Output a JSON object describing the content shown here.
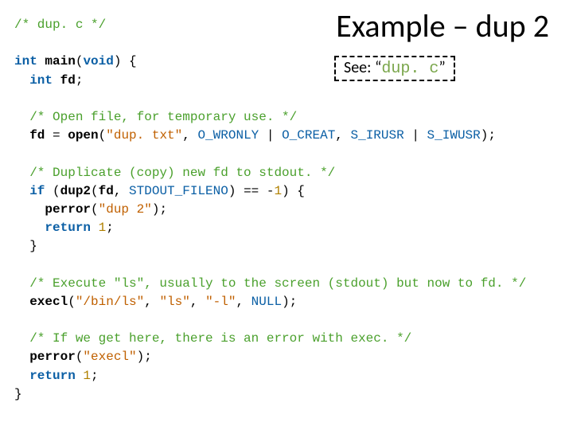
{
  "title": "Example – dup 2",
  "see": {
    "prefix": "See: “",
    "filename": "dup. c",
    "suffix": "”"
  },
  "code": {
    "l01_comment": "/* dup. c */",
    "l03_ty_int": "int",
    "l03_fn_main": "main",
    "l03_ty_void": "void",
    "l04_ty_int": "int",
    "l04_id_fd": "fd",
    "l06_comment": "/* Open file, for temporary use. */",
    "l07_id_fd": "fd",
    "l07_fn_open": "open",
    "l07_str": "\"dup. txt\"",
    "l07_c_owronly": "O_WRONLY",
    "l07_c_ocreat": "O_CREAT",
    "l07_c_sirusr": "S_IRUSR",
    "l07_c_siwusr": "S_IWUSR",
    "l09_comment": "/* Duplicate (copy) new fd to stdout. */",
    "l10_kw_if": "if",
    "l10_fn_dup2": "dup2",
    "l10_id_fd": "fd",
    "l10_c_stdout": "STDOUT_FILENO",
    "l10_num": "1",
    "l11_fn_perror": "perror",
    "l11_str": "\"dup 2\"",
    "l12_kw_return": "return",
    "l12_num": "1",
    "l15_comment": "/* Execute \"ls\", usually to the screen (stdout) but now to fd. */",
    "l16_fn_execl": "execl",
    "l16_str1": "\"/bin/ls\"",
    "l16_str2": "\"ls\"",
    "l16_str3": "\"-l\"",
    "l16_c_null": "NULL",
    "l18_comment": "/* If we get here, there is an error with exec. */",
    "l19_fn_perror": "perror",
    "l19_str": "\"execl\"",
    "l20_kw_return": "return",
    "l20_num": "1"
  }
}
